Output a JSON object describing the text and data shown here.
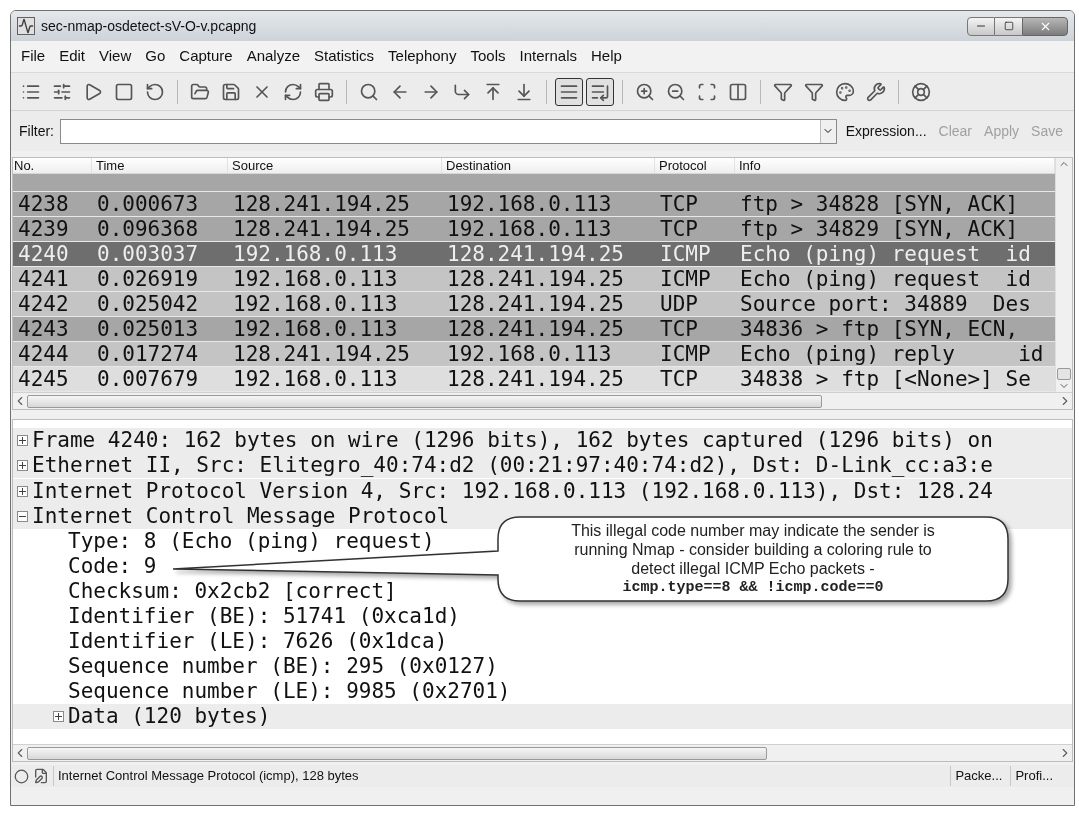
{
  "window": {
    "title": "sec-nmap-osdetect-sV-O-v.pcapng"
  },
  "menu": [
    "File",
    "Edit",
    "View",
    "Go",
    "Capture",
    "Analyze",
    "Statistics",
    "Telephony",
    "Tools",
    "Internals",
    "Help"
  ],
  "toolbar": [
    {
      "kind": "interfaces",
      "pressed": false
    },
    {
      "kind": "options",
      "pressed": false
    },
    {
      "kind": "start",
      "pressed": false
    },
    {
      "kind": "stop",
      "pressed": false
    },
    {
      "kind": "restart",
      "pressed": false
    },
    {
      "kind": "separator"
    },
    {
      "kind": "open",
      "pressed": false
    },
    {
      "kind": "save",
      "pressed": false
    },
    {
      "kind": "close",
      "pressed": false
    },
    {
      "kind": "reload",
      "pressed": false
    },
    {
      "kind": "print",
      "pressed": false
    },
    {
      "kind": "separator"
    },
    {
      "kind": "find",
      "pressed": false
    },
    {
      "kind": "back",
      "pressed": false
    },
    {
      "kind": "forward",
      "pressed": false
    },
    {
      "kind": "goto",
      "pressed": false
    },
    {
      "kind": "first",
      "pressed": false
    },
    {
      "kind": "last",
      "pressed": false
    },
    {
      "kind": "separator"
    },
    {
      "kind": "colorize",
      "pressed": true
    },
    {
      "kind": "autoscroll",
      "pressed": true
    },
    {
      "kind": "separator"
    },
    {
      "kind": "zoom-in",
      "pressed": false
    },
    {
      "kind": "zoom-out",
      "pressed": false
    },
    {
      "kind": "zoom-reset",
      "pressed": false
    },
    {
      "kind": "resize",
      "pressed": false
    },
    {
      "kind": "separator"
    },
    {
      "kind": "capture-filters",
      "pressed": false
    },
    {
      "kind": "display-filters",
      "pressed": false
    },
    {
      "kind": "coloring",
      "pressed": false
    },
    {
      "kind": "preferences",
      "pressed": false
    },
    {
      "kind": "separator"
    },
    {
      "kind": "help",
      "pressed": false
    }
  ],
  "filter": {
    "label": "Filter:",
    "buttons": [
      {
        "label": "Expression...",
        "disabled": false
      },
      {
        "label": "Clear",
        "disabled": true
      },
      {
        "label": "Apply",
        "disabled": true
      },
      {
        "label": "Save",
        "disabled": true
      }
    ]
  },
  "packet_list": {
    "columns": [
      "No.",
      "Time",
      "Source",
      "Destination",
      "Protocol",
      "Info"
    ],
    "rows": [
      {
        "no": "4238",
        "time": "0.000673",
        "source": "128.241.194.25",
        "destination": "192.168.0.113",
        "protocol": "TCP",
        "info": "ftp > 34828 [SYN, ACK]",
        "color": "#a6a6a6",
        "selected": false
      },
      {
        "no": "4239",
        "time": "0.096368",
        "source": "128.241.194.25",
        "destination": "192.168.0.113",
        "protocol": "TCP",
        "info": "ftp > 34829 [SYN, ACK]",
        "color": "#a6a6a6",
        "selected": false
      },
      {
        "no": "4240",
        "time": "0.003037",
        "source": "192.168.0.113",
        "destination": "128.241.194.25",
        "protocol": "ICMP",
        "info": "Echo (ping) request  id",
        "color": "#6e6e6e",
        "selected": true
      },
      {
        "no": "4241",
        "time": "0.026919",
        "source": "192.168.0.113",
        "destination": "128.241.194.25",
        "protocol": "ICMP",
        "info": "Echo (ping) request  id",
        "color": "#c4c4c4",
        "selected": false
      },
      {
        "no": "4242",
        "time": "0.025042",
        "source": "192.168.0.113",
        "destination": "128.241.194.25",
        "protocol": "UDP",
        "info": "Source port: 34889  Des",
        "color": "#c4c4c4",
        "selected": false
      },
      {
        "no": "4243",
        "time": "0.025013",
        "source": "192.168.0.113",
        "destination": "128.241.194.25",
        "protocol": "TCP",
        "info": "34836 > ftp [SYN, ECN,",
        "color": "#a6a6a6",
        "selected": false
      },
      {
        "no": "4244",
        "time": "0.017274",
        "source": "128.241.194.25",
        "destination": "192.168.0.113",
        "protocol": "ICMP",
        "info": "Echo (ping) reply     id",
        "color": "#c4c4c4",
        "selected": false
      },
      {
        "no": "4245",
        "time": "0.007679",
        "source": "192.168.0.113",
        "destination": "128.241.194.25",
        "protocol": "TCP",
        "info": "34838 > ftp [<None>] Se",
        "color": "#dedede",
        "selected": false
      }
    ]
  },
  "details": [
    {
      "text": "Frame 4240: 162 bytes on wire (1296 bits), 162 bytes captured (1296 bits) on",
      "expanded": false
    },
    {
      "text": "Ethernet II, Src: Elitegro_40:74:d2 (00:21:97:40:74:d2), Dst: D-Link_cc:a3:e",
      "expanded": false
    },
    {
      "text": "Internet Protocol Version 4, Src: 192.168.0.113 (192.168.0.113), Dst: 128.24",
      "expanded": false
    },
    {
      "text": "Internet Control Message Protocol",
      "expanded": true,
      "children": [
        {
          "text": "Type: 8 (Echo (ping) request)"
        },
        {
          "text": "Code: 9"
        },
        {
          "text": "Checksum: 0x2cb2 [correct]"
        },
        {
          "text": "Identifier (BE): 51741 (0xca1d)"
        },
        {
          "text": "Identifier (LE): 7626 (0x1dca)"
        },
        {
          "text": "Sequence number (BE): 295 (0x0127)"
        },
        {
          "text": "Sequence number (LE): 9985 (0x2701)"
        },
        {
          "text": "Data (120 bytes)",
          "expanded": false
        }
      ]
    }
  ],
  "callout": {
    "text": "This illegal code number may indicate the sender is running Nmap - consider building a coloring rule to detect illegal ICMP Echo packets -",
    "code": "icmp.type==8 && !icmp.code==0"
  },
  "status_bar": {
    "text": "Internet Control Message Protocol (icmp), 128 bytes",
    "panes": [
      "Packe...",
      "Profi..."
    ]
  }
}
